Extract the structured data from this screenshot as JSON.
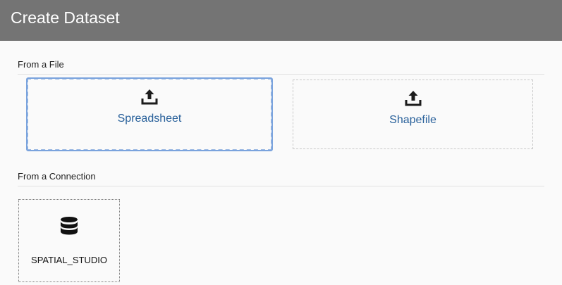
{
  "header": {
    "title": "Create Dataset"
  },
  "from_file": {
    "label": "From a File",
    "tiles": [
      {
        "label": "Spreadsheet",
        "icon": "upload-icon",
        "focused": true
      },
      {
        "label": "Shapefile",
        "icon": "upload-icon",
        "focused": false
      }
    ]
  },
  "from_connection": {
    "label": "From a Connection",
    "connections": [
      {
        "label": "SPATIAL_STUDIO",
        "icon": "database-icon"
      }
    ]
  },
  "colors": {
    "header_bg": "#747474",
    "link_blue": "#28609a",
    "focus_blue": "#7aa3dd"
  }
}
